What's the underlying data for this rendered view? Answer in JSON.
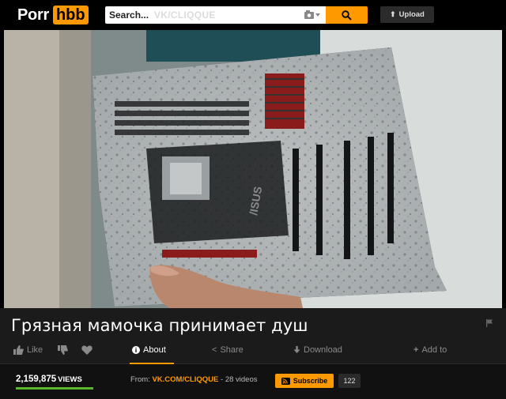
{
  "header": {
    "logo_part1": "Porr",
    "logo_part2": "hbb",
    "search_placeholder": "Search...",
    "search_watermark": "VK/CLIQQUE",
    "upload_label": "Upload"
  },
  "video": {
    "description": "Motherboard covered in soap foam being washed"
  },
  "video_title": "Грязная мамочка принимает душ",
  "actions": {
    "like": "Like",
    "about": "About",
    "share": "Share",
    "download": "Download",
    "add_to": "Add to"
  },
  "stats": {
    "views_count": "2,159,875",
    "views_label": "VIEWS",
    "rating_percent": 100
  },
  "channel": {
    "from_label": "From:",
    "name": "VK.COM/CLIQQUE",
    "videos": "- 28 videos",
    "subscribe_label": "Subscribe",
    "subscriber_count": "122"
  },
  "colors": {
    "accent": "#ff9900",
    "background": "#1b1b1b",
    "rating": "#5ab62a"
  }
}
